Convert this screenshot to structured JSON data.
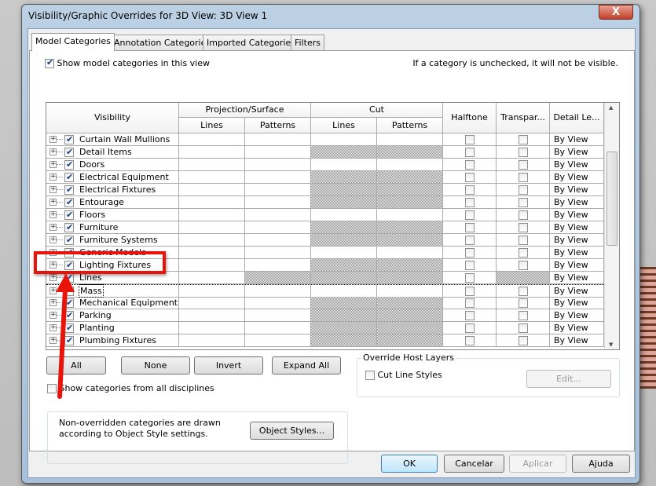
{
  "dialog": {
    "title": "Visibility/Graphic Overrides for 3D View: 3D View 1",
    "close_label": "X"
  },
  "tabs": [
    {
      "label": "Model Categories",
      "active": true
    },
    {
      "label": "Annotation Categories"
    },
    {
      "label": "Imported Categories"
    },
    {
      "label": "Filters"
    }
  ],
  "show_model_categories": {
    "label": "Show model categories in this view",
    "checked": true
  },
  "hint": "If a category is unchecked, it will not be visible.",
  "headers": {
    "visibility": "Visibility",
    "projection": "Projection/Surface",
    "cut": "Cut",
    "lines": "Lines",
    "patterns": "Patterns",
    "halftone": "Halftone",
    "transparency": "Transpar...",
    "detail": "Detail Le..."
  },
  "rows": [
    {
      "name": "Curtain Wall Mullions",
      "visible": true,
      "cut_na": false,
      "detail": "By View"
    },
    {
      "name": "Detail Items",
      "visible": true,
      "cut_na": true,
      "detail": "By View"
    },
    {
      "name": "Doors",
      "visible": true,
      "cut_na": false,
      "detail": "By View"
    },
    {
      "name": "Electrical Equipment",
      "visible": true,
      "cut_na": true,
      "detail": "By View"
    },
    {
      "name": "Electrical Fixtures",
      "visible": true,
      "cut_na": true,
      "detail": "By View"
    },
    {
      "name": "Entourage",
      "visible": true,
      "cut_na": true,
      "detail": "By View"
    },
    {
      "name": "Floors",
      "visible": true,
      "cut_na": false,
      "detail": "By View"
    },
    {
      "name": "Furniture",
      "visible": true,
      "cut_na": true,
      "detail": "By View"
    },
    {
      "name": "Furniture Systems",
      "visible": true,
      "cut_na": true,
      "detail": "By View"
    },
    {
      "name": "Generic Models",
      "visible": true,
      "cut_na": false,
      "detail": "By View"
    },
    {
      "name": "Lighting Fixtures",
      "visible": true,
      "cut_na": true,
      "detail": "By View"
    },
    {
      "name": "Lines",
      "visible": true,
      "cut_na": true,
      "patterns_na": true,
      "transp_na": true,
      "detail": "By View"
    },
    {
      "name": "Mass",
      "visible": false,
      "cut_na": false,
      "detail": "By View",
      "selected": true
    },
    {
      "name": "Mechanical Equipment",
      "visible": true,
      "cut_na": true,
      "detail": "By View"
    },
    {
      "name": "Parking",
      "visible": true,
      "cut_na": true,
      "detail": "By View"
    },
    {
      "name": "Planting",
      "visible": true,
      "cut_na": true,
      "detail": "By View"
    },
    {
      "name": "Plumbing Fixtures",
      "visible": true,
      "cut_na": true,
      "detail": "By View"
    }
  ],
  "buttons": {
    "all": "All",
    "none": "None",
    "invert": "Invert",
    "expand_all": "Expand All",
    "object_styles": "Object Styles...",
    "edit": "Edit...",
    "ok": "OK",
    "cancel": "Cancelar",
    "apply": "Aplicar",
    "help": "Ajuda"
  },
  "show_all_disciplines": {
    "label": "Show categories from all disciplines",
    "checked": false
  },
  "object_styles_note": "Non-overridden categories are drawn according to Object Style settings.",
  "override_host": {
    "title": "Override Host Layers",
    "cut_line_styles": "Cut Line Styles",
    "checked": false
  },
  "annotation_color": "#e8140c"
}
